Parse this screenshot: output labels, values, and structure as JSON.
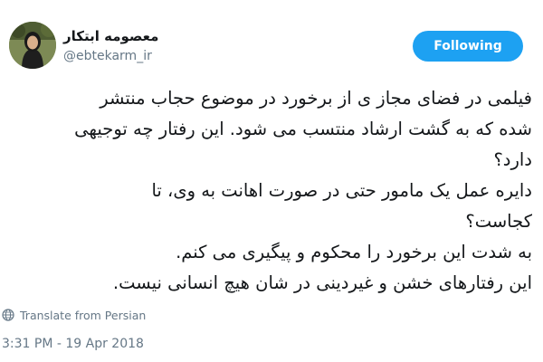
{
  "author": {
    "display_name": "معصومه ابتکار",
    "handle": "@ebtekarm_ir"
  },
  "follow_button": {
    "label": "Following",
    "color": "#1da1f2"
  },
  "tweet": {
    "lines": [
      "فیلمی در فضای مجاز ی از برخورد در موضوع حجاب منتشر",
      "شده که به گشت ارشاد منتسب می شود. این رفتار چه توجیهی",
      "دارد؟",
      "دایره عمل یک مامور حتی در صورت اهانت به وی، تا",
      "کجاست؟",
      "به شدت این برخورد را محکوم و پیگیری می کنم.",
      "این رفتارهای خشن و غیردینی در شان هیچ انسانی نیست."
    ]
  },
  "translate": {
    "label": "Translate from Persian",
    "icon": "globe-icon"
  },
  "timestamp": "3:31 PM - 19 Apr 2018"
}
